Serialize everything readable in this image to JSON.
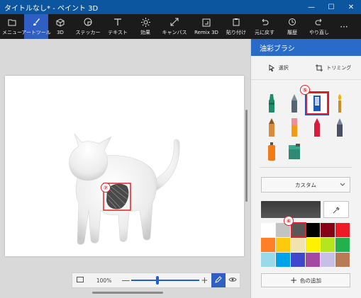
{
  "window": {
    "title": "タイトルなし* - ペイント 3D",
    "minimize": "—",
    "maximize": "☐",
    "close": "✕"
  },
  "toolbar": {
    "items": [
      {
        "label": "メニュー",
        "icon": "folder-icon"
      },
      {
        "label": "アートツール",
        "icon": "brush-icon",
        "active": true
      },
      {
        "label": "3D",
        "icon": "cube-icon"
      },
      {
        "label": "ステッカー",
        "icon": "sticker-icon"
      },
      {
        "label": "テキスト",
        "icon": "text-icon"
      },
      {
        "label": "効果",
        "icon": "sun-icon"
      },
      {
        "label": "キャンバス",
        "icon": "canvas-icon"
      },
      {
        "label": "Remix 3D",
        "icon": "remix-icon"
      },
      {
        "label": "貼り付け",
        "icon": "paste-icon"
      },
      {
        "label": "元に戻す",
        "icon": "undo-icon"
      },
      {
        "label": "履歴",
        "icon": "history-icon"
      },
      {
        "label": "やり直し",
        "icon": "redo-icon"
      },
      {
        "label": "",
        "icon": "more-icon"
      }
    ],
    "more": "···"
  },
  "canvas": {
    "annotation_7": "⑦"
  },
  "zoom": {
    "percent": "100%",
    "minus": "—",
    "plus": "+",
    "level": 0.375
  },
  "panel": {
    "title": "油彩ブラシ",
    "select_label": "選択",
    "crop_label": "トリミング",
    "annotation_5": "⑤",
    "annotation_6": "⑥",
    "brushes": [
      {
        "name": "marker",
        "color": "#1e8c6a"
      },
      {
        "name": "calligraphy-pen",
        "color": "#7f8c8d"
      },
      {
        "name": "oil-brush",
        "color": "#1a56b5",
        "selected": true
      },
      {
        "name": "watercolor",
        "color": "#f0b400"
      },
      {
        "name": "pencil",
        "color": "#d98c3a"
      },
      {
        "name": "eraser",
        "color": "#ee8d9b"
      },
      {
        "name": "crayon",
        "color": "#d81b3c"
      },
      {
        "name": "pixel-pen",
        "color": "#7a7f9a"
      },
      {
        "name": "spray-can",
        "color": "#f07c19"
      },
      {
        "name": "fill-bucket",
        "color": "#2f8a74"
      }
    ],
    "texture_dropdown": "カスタム",
    "add_color_label": "色の追加",
    "colors": [
      "#ffffff",
      "#c3c3c3",
      "#585858",
      "#000000",
      "#880015",
      "#ed1c24",
      "#ff7f27",
      "#ffc90e",
      "#efe4b0",
      "#fff200",
      "#b5e61d",
      "#22b14c",
      "#99d9ea",
      "#00a2e8",
      "#3f48cc",
      "#a349a4",
      "#c8bfe7",
      "#b97a57"
    ]
  }
}
